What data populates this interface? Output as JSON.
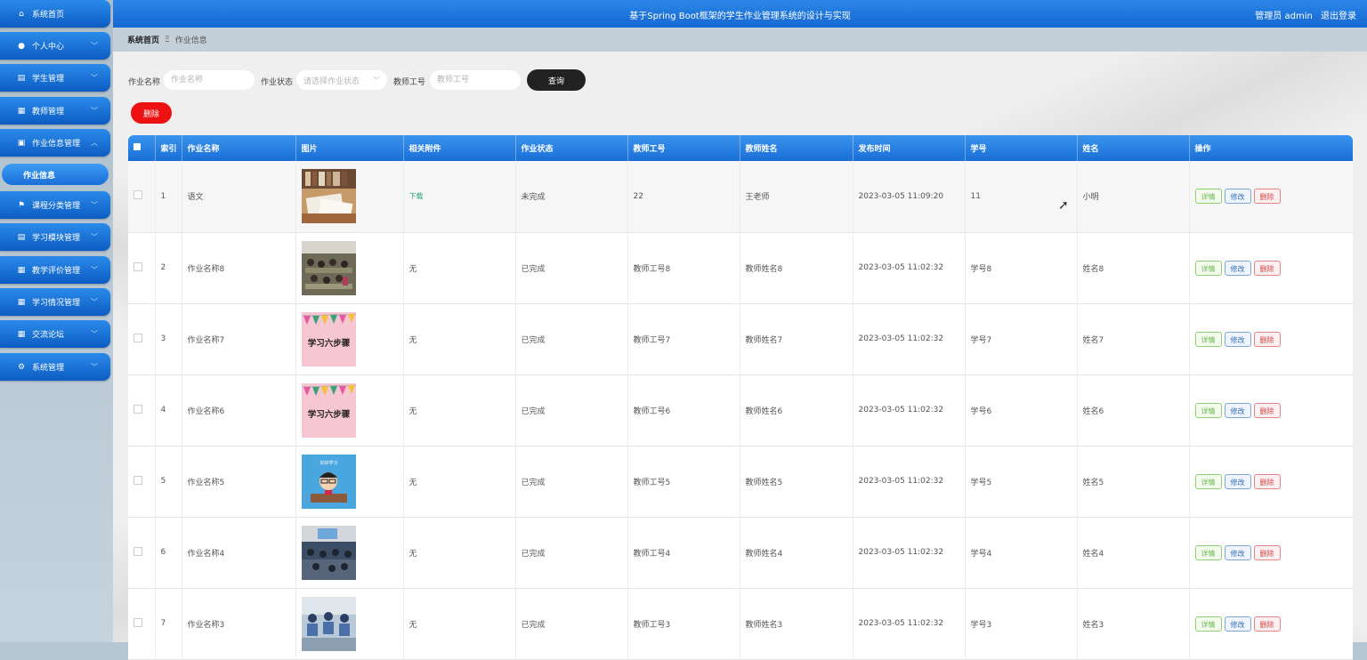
{
  "app": {
    "title": "基于Spring Boot框架的学生作业管理系统的设计与实现",
    "user_label": "管理员 admin",
    "logout": "退出登录"
  },
  "sidebar": {
    "items": [
      {
        "label": "系统首页",
        "icon": "home-icon"
      },
      {
        "label": "个人中心",
        "icon": "user-icon"
      },
      {
        "label": "学生管理",
        "icon": "clipboard-icon"
      },
      {
        "label": "教师管理",
        "icon": "grid-icon"
      },
      {
        "label": "作业信息管理",
        "icon": "briefcase-icon"
      },
      {
        "label": "课程分类管理",
        "icon": "flag-icon"
      },
      {
        "label": "学习模块管理",
        "icon": "clipboard-icon"
      },
      {
        "label": "教学评价管理",
        "icon": "grid-icon"
      },
      {
        "label": "学习情况管理",
        "icon": "grid-icon"
      },
      {
        "label": "交流论坛",
        "icon": "grid-icon"
      },
      {
        "label": "系统管理",
        "icon": "gear-box-icon"
      }
    ],
    "active_sub": "作业信息"
  },
  "breadcrumb": {
    "home": "系统首页",
    "separator": "Ξ",
    "current": "作业信息"
  },
  "search": {
    "name_label": "作业名称",
    "name_placeholder": "作业名称",
    "status_label": "作业状态",
    "status_placeholder": "请选择作业状态",
    "teacher_label": "教师工号",
    "teacher_placeholder": "教师工号",
    "query_button": "查询",
    "delete_button": "删除"
  },
  "table": {
    "headers": [
      "索引",
      "作业名称",
      "图片",
      "相关附件",
      "作业状态",
      "教师工号",
      "教师姓名",
      "发布时间",
      "学号",
      "姓名",
      "操作"
    ],
    "ops": {
      "detail": "详情",
      "edit": "修改",
      "delete": "删除"
    },
    "rows": [
      {
        "index": "1",
        "name": "语文",
        "image": "books",
        "attachment": "下载",
        "status": "未完成",
        "teacher_no": "22",
        "teacher_name": "王老师",
        "time": "2023-03-05 11:09:20",
        "student_no": "11",
        "student_name": "小明"
      },
      {
        "index": "2",
        "name": "作业名称8",
        "image": "classroom",
        "attachment": "无",
        "status": "已完成",
        "teacher_no": "教师工号8",
        "teacher_name": "教师姓名8",
        "time": "2023-03-05 11:02:32",
        "student_no": "学号8",
        "student_name": "姓名8"
      },
      {
        "index": "3",
        "name": "作业名称7",
        "image": "banner",
        "attachment": "无",
        "status": "已完成",
        "teacher_no": "教师工号7",
        "teacher_name": "教师姓名7",
        "time": "2023-03-05 11:02:32",
        "student_no": "学号7",
        "student_name": "姓名7"
      },
      {
        "index": "4",
        "name": "作业名称6",
        "image": "banner",
        "attachment": "无",
        "status": "已完成",
        "teacher_no": "教师工号6",
        "teacher_name": "教师姓名6",
        "time": "2023-03-05 11:02:32",
        "student_no": "学号6",
        "student_name": "姓名6"
      },
      {
        "index": "5",
        "name": "作业名称5",
        "image": "cartoon",
        "attachment": "无",
        "status": "已完成",
        "teacher_no": "教师工号5",
        "teacher_name": "教师姓名5",
        "time": "2023-03-05 11:02:32",
        "student_no": "学号5",
        "student_name": "姓名5"
      },
      {
        "index": "6",
        "name": "作业名称4",
        "image": "lecture",
        "attachment": "无",
        "status": "已完成",
        "teacher_no": "教师工号4",
        "teacher_name": "教师姓名4",
        "time": "2023-03-05 11:02:32",
        "student_no": "学号4",
        "student_name": "姓名4"
      },
      {
        "index": "7",
        "name": "作业名称3",
        "image": "students",
        "attachment": "无",
        "status": "已完成",
        "teacher_no": "教师工号3",
        "teacher_name": "教师姓名3",
        "time": "2023-03-05 11:02:32",
        "student_no": "学号3",
        "student_name": "姓名3"
      }
    ]
  },
  "thumb_text": "学习六步骤",
  "cartoon_text": "好好学习"
}
